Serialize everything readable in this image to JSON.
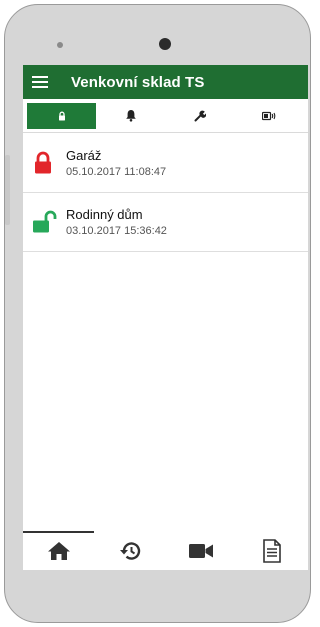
{
  "app": {
    "title": "Venkovní sklad TS"
  },
  "tabs": [
    {
      "icon": "lock-icon",
      "active": true
    },
    {
      "icon": "bell-icon",
      "active": false
    },
    {
      "icon": "wrench-icon",
      "active": false
    },
    {
      "icon": "battery-icon",
      "active": false
    }
  ],
  "items": [
    {
      "name": "Garáž",
      "timestamp": "05.10.2017 11:08:47",
      "state": "locked",
      "color": "#e2262b"
    },
    {
      "name": "Rodinný dům",
      "timestamp": "03.10.2017 15:36:42",
      "state": "unlocked",
      "color": "#27a85a"
    }
  ],
  "bottom_nav": [
    {
      "icon": "home-icon",
      "active": true
    },
    {
      "icon": "history-icon",
      "active": false
    },
    {
      "icon": "video-camera-icon",
      "active": false
    },
    {
      "icon": "document-icon",
      "active": false
    }
  ],
  "colors": {
    "appbar": "#1f6e32",
    "active_tab": "#1f7a38",
    "locked": "#e2262b",
    "unlocked": "#27a85a"
  }
}
